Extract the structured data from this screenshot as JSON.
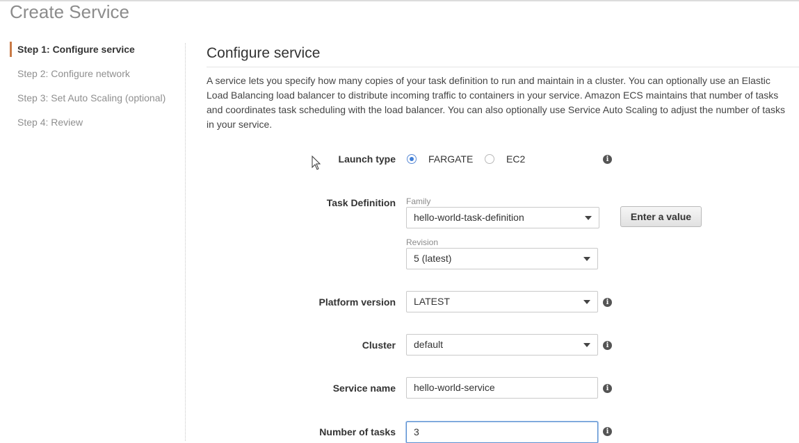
{
  "page": {
    "title": "Create Service"
  },
  "steps": [
    {
      "label": "Step 1: Configure service",
      "active": true
    },
    {
      "label": "Step 2: Configure network",
      "active": false
    },
    {
      "label": "Step 3: Set Auto Scaling (optional)",
      "active": false
    },
    {
      "label": "Step 4: Review",
      "active": false
    }
  ],
  "section": {
    "title": "Configure service",
    "description": "A service lets you specify how many copies of your task definition to run and maintain in a cluster. You can optionally use an Elastic Load Balancing load balancer to distribute incoming traffic to containers in your service. Amazon ECS maintains that number of tasks and coordinates task scheduling with the load balancer. You can also optionally use Service Auto Scaling to adjust the number of tasks in your service."
  },
  "form": {
    "launch_type": {
      "label": "Launch type",
      "options": [
        {
          "label": "FARGATE",
          "selected": true
        },
        {
          "label": "EC2",
          "selected": false
        }
      ]
    },
    "task_definition": {
      "label": "Task Definition",
      "family_label": "Family",
      "family_value": "hello-world-task-definition",
      "revision_label": "Revision",
      "revision_value": "5 (latest)",
      "enter_value_button": "Enter a value"
    },
    "platform_version": {
      "label": "Platform version",
      "value": "LATEST"
    },
    "cluster": {
      "label": "Cluster",
      "value": "default"
    },
    "service_name": {
      "label": "Service name",
      "value": "hello-world-service"
    },
    "number_of_tasks": {
      "label": "Number of tasks",
      "value": "3"
    }
  },
  "icons": {
    "info": "info-icon",
    "dropdown": "chevron-down-icon",
    "cursor": "mouse-pointer-icon"
  },
  "colors": {
    "active_step_marker": "#c97a46",
    "radio_selected": "#3f7ed6",
    "focus_border": "#5a8fd0"
  },
  "glyphs": {
    "info": "i"
  }
}
